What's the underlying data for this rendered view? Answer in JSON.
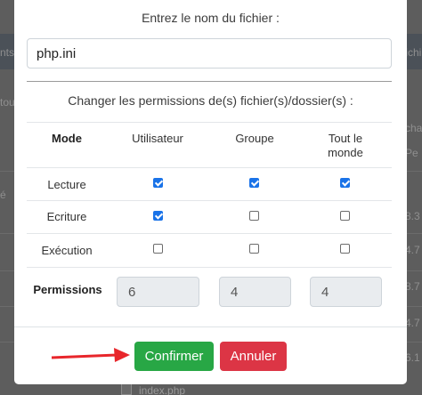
{
  "background": {
    "fragments": [
      "nts",
      "fichi",
      "tou",
      "é",
      "cha",
      "Pe",
      "8.3",
      "4.7",
      "8.7",
      "4.7",
      "6.1",
      "index.php"
    ],
    "file_name": "index.php"
  },
  "dialog": {
    "filename_label": "Entrez le nom du fichier :",
    "filename_value": "php.ini",
    "permissions_label": "Changer les permissions de(s) fichier(s)/dossier(s) :",
    "columns": {
      "mode": "Mode",
      "user": "Utilisateur",
      "group": "Groupe",
      "all_line1": "Tout le",
      "all_line2": "monde"
    },
    "rows": [
      {
        "label": "Lecture",
        "user": true,
        "group": true,
        "all": true
      },
      {
        "label": "Ecriture",
        "user": true,
        "group": false,
        "all": false
      },
      {
        "label": "Exécution",
        "user": false,
        "group": false,
        "all": false
      }
    ],
    "permissions_row_label": "Permissions",
    "permission_values": {
      "user": "6",
      "group": "4",
      "all": "4"
    },
    "confirm_label": "Confirmer",
    "cancel_label": "Annuler"
  },
  "colors": {
    "confirm": "#28a745",
    "cancel": "#dc3545",
    "checkbox": "#1a73e8",
    "annotation_arrow": "#e8262b"
  },
  "icons": [
    "annotation-arrow-icon",
    "file-icon",
    "checkbox-checked",
    "checkbox-unchecked"
  ]
}
